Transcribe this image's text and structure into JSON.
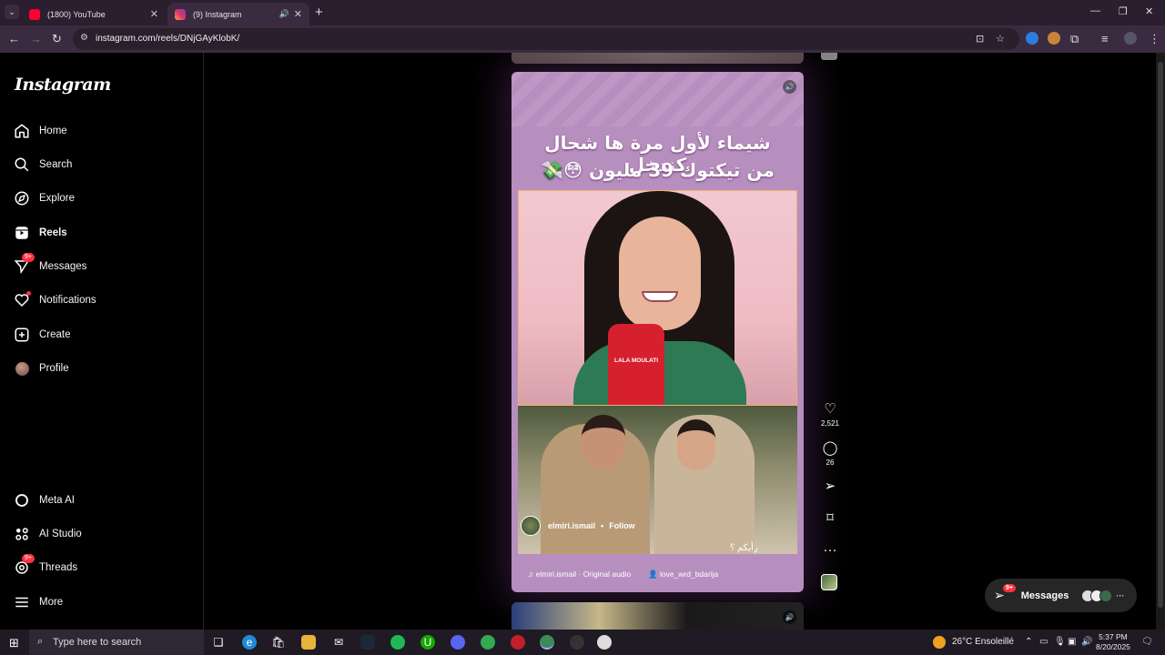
{
  "browser": {
    "tabs": [
      {
        "title": "(1800) YouTube",
        "active": false
      },
      {
        "title": "(9) Instagram",
        "active": true
      }
    ],
    "url": "instagram.com/reels/DNjGAyKlobK/"
  },
  "sidebar": {
    "logo": "Instagram",
    "items": [
      {
        "label": "Home",
        "icon": "home-icon"
      },
      {
        "label": "Search",
        "icon": "search-icon"
      },
      {
        "label": "Explore",
        "icon": "compass-icon"
      },
      {
        "label": "Reels",
        "icon": "reels-icon"
      },
      {
        "label": "Messages",
        "icon": "send-icon",
        "badge": "9+"
      },
      {
        "label": "Notifications",
        "icon": "heart-icon"
      },
      {
        "label": "Create",
        "icon": "plus-square-icon"
      },
      {
        "label": "Profile",
        "icon": "avatar"
      },
      {
        "label": "Meta AI",
        "icon": "meta-ai-icon"
      },
      {
        "label": "AI Studio",
        "icon": "ai-studio-icon"
      },
      {
        "label": "Threads",
        "icon": "threads-icon",
        "badge": "9+"
      },
      {
        "label": "More",
        "icon": "menu-icon"
      }
    ]
  },
  "reel": {
    "headline_line1": "شيماء لأول مرة ها شحال كندخل",
    "headline_line2": "من تيكتوك 39 مليون 😳💸",
    "mic_label": "LALA MOULATI",
    "caption_overlay": "رأيكم ؟",
    "username": "elmiri.ismail",
    "follow": "Follow",
    "separator": "•",
    "audio": "elmiri.ismail · Original audio",
    "tagged_user": "love_wrd_bdarija",
    "likes": "2,521",
    "comments": "26"
  },
  "messages_pill": {
    "label": "Messages",
    "badge": "9+"
  },
  "taskbar": {
    "search_placeholder": "Type here to search",
    "weather": "26°C  Ensoleillé",
    "time": "5:37 PM",
    "date": "8/20/2025"
  },
  "colors": {
    "reel_bg": "#b78fbf",
    "badge": "#ff3040",
    "tab_bar": "#2b1e2f"
  }
}
